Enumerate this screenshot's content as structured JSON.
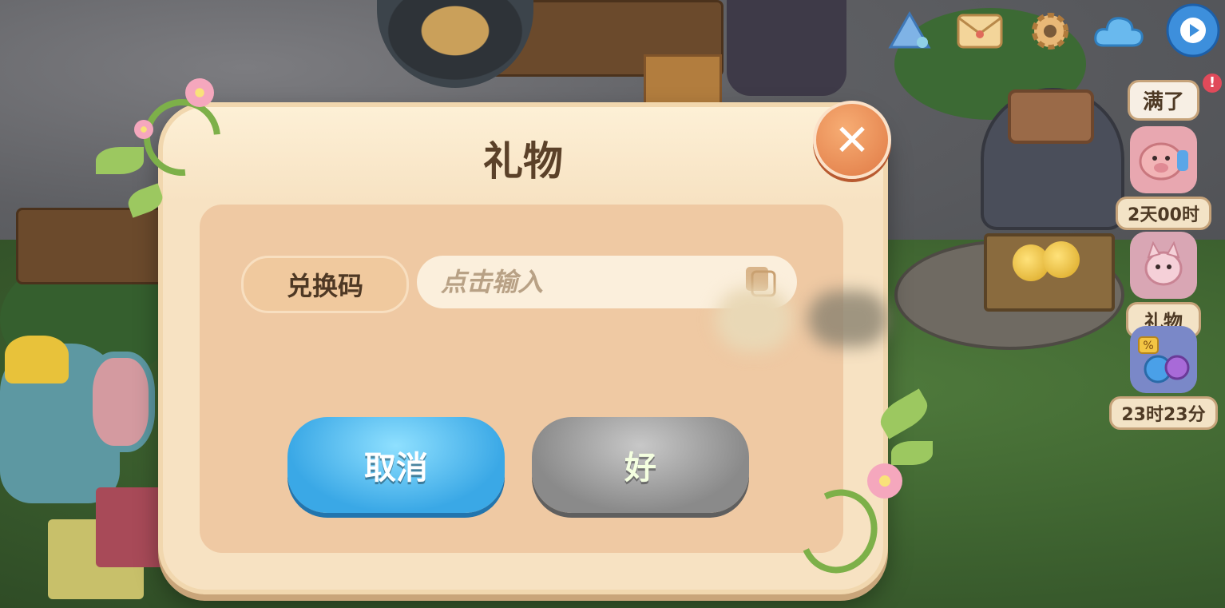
{
  "dialog": {
    "title": "礼物",
    "code_label": "兑换码",
    "input_placeholder": "点击输入",
    "input_value": "",
    "cancel_label": "取消",
    "ok_label": "好",
    "close_symbol": "✕"
  },
  "side_panel": {
    "status_badge": "满了",
    "piggy_timer": "2天00时",
    "gift_label": "礼物",
    "sale_timer": "23时23分"
  },
  "icons": {
    "hud": [
      "pyramid-icon",
      "mail-icon",
      "gear-icon",
      "cloud-icon",
      "play-icon"
    ],
    "close": "close-icon",
    "paste": "paste-icon"
  },
  "colors": {
    "cancel_button": "#3aa8e6",
    "ok_button_disabled": "#8a8a8a",
    "close_button": "#e07a45",
    "dialog_bg": "#f7e2c2"
  }
}
